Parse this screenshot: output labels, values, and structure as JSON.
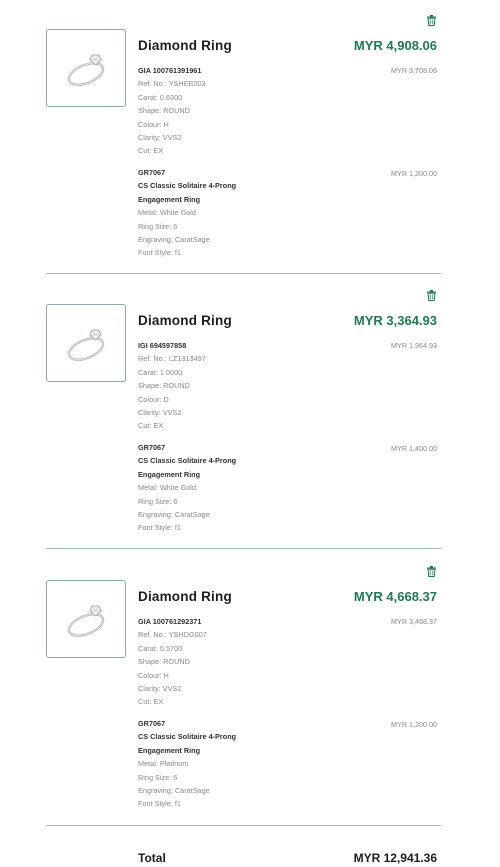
{
  "colors": {
    "accent": "#1f7a4f",
    "border": "#8aa9b6",
    "muted": "#8a8a8a"
  },
  "icons": {
    "remove": "trash-icon",
    "thumbnail": "ring-image"
  },
  "items": [
    {
      "title": "Diamond Ring",
      "total": "MYR 4,908.06",
      "diamond": {
        "name": "GIA 100761391961",
        "price": "MYR 3,708.06",
        "details": [
          "Ref. No.: YSHEE003",
          "Carat: 0.6300",
          "Shape: ROUND",
          "Colour: H",
          "Clarity: VVS2",
          "Cut: EX"
        ]
      },
      "setting": {
        "code": "GR7067",
        "name_line1": "CS Classic Solitaire 4-Prong",
        "name_line2": "Engagement Ring",
        "price": "MYR 1,200.00",
        "details": [
          "Metal: White Gold",
          "Ring Size: 6",
          "Engraving: CaratSage",
          "Font Style: f1"
        ]
      }
    },
    {
      "title": "Diamond Ring",
      "total": "MYR 3,364.93",
      "diamond": {
        "name": "IGI 694597858",
        "price": "MYR 1,964.93",
        "details": [
          "Ref. No.: LZ1313497",
          "Carat: 1.0000",
          "Shape: ROUND",
          "Colour: D",
          "Clarity: VVS2",
          "Cut: EX"
        ]
      },
      "setting": {
        "code": "GR7067",
        "name_line1": "CS Classic Solitaire 4-Prong",
        "name_line2": "Engagement Ring",
        "price": "MYR 1,400.00",
        "details": [
          "Metal: White Gold",
          "Ring Size: 6",
          "Engraving: CaratSage",
          "Font Style: f1"
        ]
      }
    },
    {
      "title": "Diamond Ring",
      "total": "MYR 4,668.37",
      "diamond": {
        "name": "GIA 100761292371",
        "price": "MYR 3,468.37",
        "details": [
          "Ref. No.: YSHDG007",
          "Carat: 0.5700",
          "Shape: ROUND",
          "Colour: H",
          "Clarity: VVS2",
          "Cut: EX"
        ]
      },
      "setting": {
        "code": "GR7067",
        "name_line1": "CS Classic Solitaire 4-Prong",
        "name_line2": "Engagement Ring",
        "price": "MYR 1,200.00",
        "details": [
          "Metal: Platinum",
          "Ring Size: 6",
          "Engraving: CaratSage",
          "Font Style: f1"
        ]
      }
    }
  ],
  "summary": {
    "label": "Total",
    "value": "MYR 12,941.36"
  }
}
